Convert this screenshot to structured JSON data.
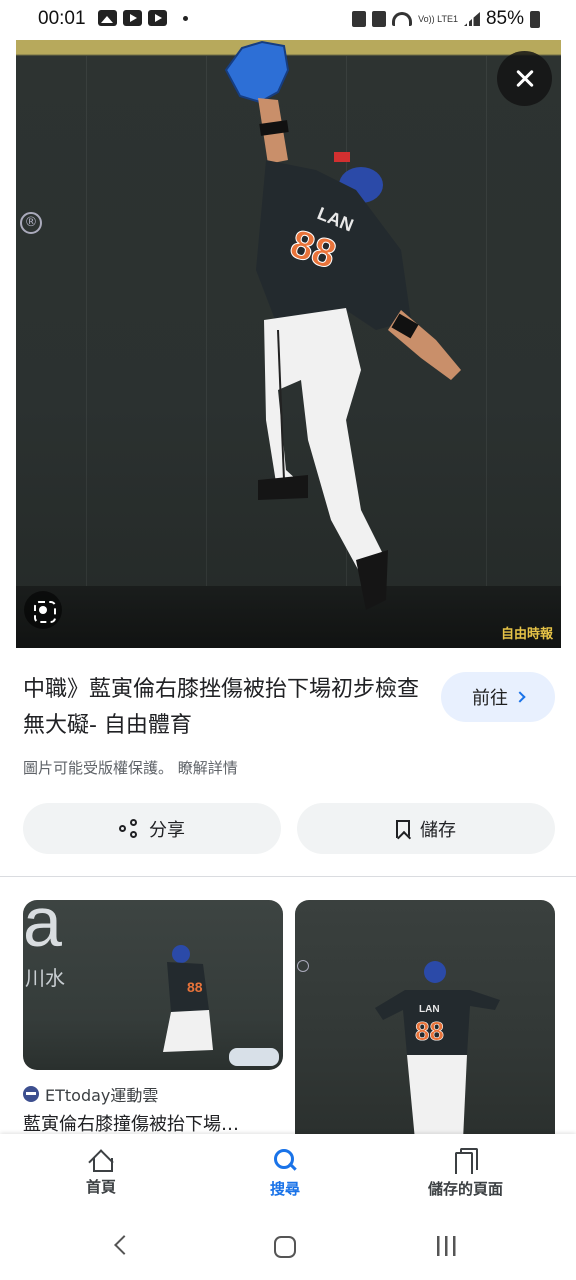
{
  "status_bar": {
    "time": "00:01",
    "battery": "85%",
    "network_label": "Vo)) LTE1"
  },
  "hero": {
    "watermark": "自由時報",
    "registered_mark": "®",
    "jersey_text": "LAN",
    "jersey_number": "88"
  },
  "result": {
    "title": "中職》藍寅倫右膝挫傷被抬下場初步檢查無大礙- 自由體育",
    "visit_label": "前往",
    "copyright_notice": "圖片可能受版權保護。 瞭解詳情",
    "share_label": "分享",
    "save_label": "儲存"
  },
  "related": [
    {
      "source": "ETtoday運動雲",
      "title": "藍寅倫右膝撞傷被抬下場…",
      "bg_letter": "a",
      "bg_text": "川水"
    },
    {
      "source": "",
      "title": ""
    }
  ],
  "bottom_nav": {
    "items": [
      {
        "label": "首頁",
        "icon": "home-icon",
        "active": false
      },
      {
        "label": "搜尋",
        "icon": "search-icon",
        "active": true
      },
      {
        "label": "儲存的頁面",
        "icon": "saved-pages-icon",
        "active": false
      }
    ]
  },
  "colors": {
    "accent": "#1a73e8",
    "visit_button_bg": "#e8f0fe",
    "chip_bg": "#f1f3f4",
    "jersey": "#232a2e",
    "number": "#e8733a",
    "helmet": "#2b4aa8",
    "glove": "#2d6fd6"
  }
}
